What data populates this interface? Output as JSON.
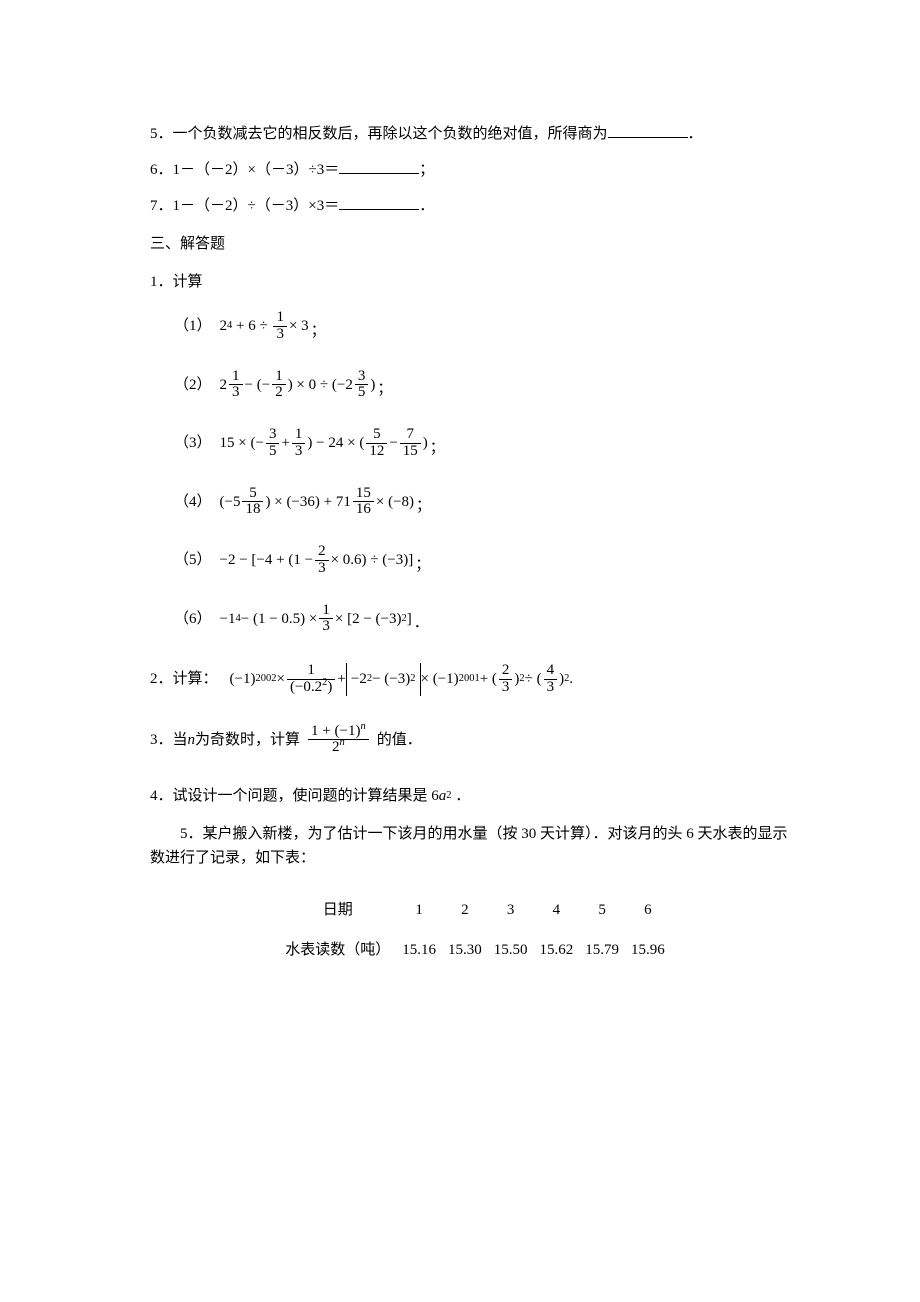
{
  "q5_text": "5．一个负数减去它的相反数后，再除以这个负数的绝对值，所得商为",
  "q5_period": "．",
  "q6_prefix": "6．1－（－2）×（－3）÷3＝",
  "q6_suffix": "；",
  "q7_prefix": "7．1－（－2）÷（－3）×3＝",
  "q7_suffix": "．",
  "section3": "三、解答题",
  "p1_label": "1．计算",
  "items": {
    "i1": {
      "num": "（1）"
    },
    "i2": {
      "num": "（2）"
    },
    "i3": {
      "num": "（3）"
    },
    "i4": {
      "num": "（4）"
    },
    "i5": {
      "num": "（5）"
    },
    "i6": {
      "num": "（6）"
    }
  },
  "p2_label": "2．计算：",
  "p3_prefix": "3．当 ",
  "p3_var": "n",
  "p3_mid": " 为奇数时，计算",
  "p3_suffix": "的值．",
  "p4_prefix": "4．试设计一个问题，使问题的计算结果是",
  "p4_expr_six": "6",
  "p4_expr_a": "a",
  "p4_expr_sq": "2",
  "p4_suffix": "．",
  "p5_text": "5．某户搬入新楼，为了估计一下该月的用水量（按 30 天计算）．对该月的头 6 天水表的显示数进行了记录，如下表：",
  "table": {
    "row1_label": "日期",
    "row2_label": "水表读数（吨）",
    "days": [
      "1",
      "2",
      "3",
      "4",
      "5",
      "6"
    ],
    "readings": [
      "15.16",
      "15.30",
      "15.50",
      "15.62",
      "15.79",
      "15.96"
    ]
  }
}
